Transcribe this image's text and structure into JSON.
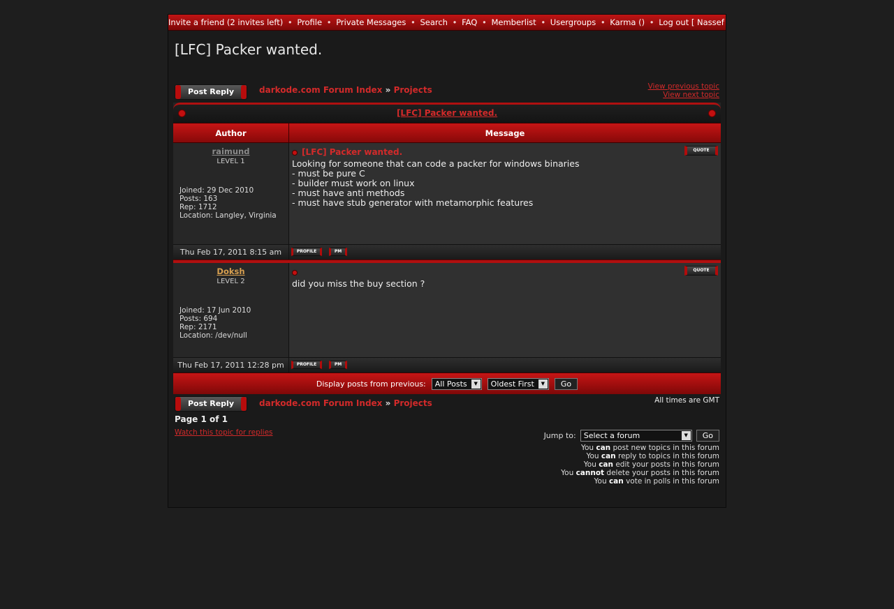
{
  "nav": {
    "items": [
      "Invite a friend (2 invites left)",
      "Profile",
      "Private Messages",
      "Search",
      "FAQ",
      "Memberlist",
      "Usergroups",
      "Karma ()",
      "Log out [ Nassef ]"
    ],
    "separator": "•"
  },
  "page_title": "[LFC] Packer wanted.",
  "post_reply_label": "Post Reply",
  "breadcrumb": {
    "index": "darkode.com Forum Index",
    "arrow": "»",
    "forum": "Projects"
  },
  "topic_links": {
    "previous": "View previous topic",
    "next": "View next topic"
  },
  "panel": {
    "title": "[LFC] Packer wanted.",
    "col_author": "Author",
    "col_message": "Message"
  },
  "posts": [
    {
      "author": "raimund",
      "level": "LEVEL 1",
      "joined": "Joined: 29 Dec 2010",
      "posts": "Posts: 163",
      "rep": "Rep: 1712",
      "location": "Location: Langley, Virginia",
      "subject": "[LFC] Packer wanted.",
      "body": [
        "Looking for someone that can code a packer for windows binaries",
        "- must be pure C",
        "- builder must work on linux",
        "- must have anti methods",
        "- must have stub generator with metamorphic features"
      ],
      "date": "Thu Feb 17, 2011 8:15 am"
    },
    {
      "author": "Doksh",
      "level": "LEVEL 2",
      "joined": "Joined: 17 Jun 2010",
      "posts": "Posts: 694",
      "rep": "Rep: 2171",
      "location": "Location: /dev/null",
      "subject": "",
      "body": [
        "did you miss the buy section ?"
      ],
      "date": "Thu Feb 17, 2011 12:28 pm"
    }
  ],
  "buttons": {
    "quote": "QUOTE",
    "profile": "PROFILE",
    "pm": "PM"
  },
  "sort": {
    "label": "Display posts from previous:",
    "period": "All Posts",
    "order": "Oldest First",
    "go": "Go"
  },
  "timezone": "All times are GMT",
  "pagination": "Page 1 of 1",
  "watch_link": "Watch this topic for replies",
  "jump": {
    "label": "Jump to:",
    "select": "Select a forum",
    "go": "Go"
  },
  "permissions": [
    {
      "pre": "You ",
      "mode": "can",
      "post": " post new topics in this forum"
    },
    {
      "pre": "You ",
      "mode": "can",
      "post": " reply to topics in this forum"
    },
    {
      "pre": "You ",
      "mode": "can",
      "post": " edit your posts in this forum"
    },
    {
      "pre": "You ",
      "mode": "cannot",
      "post": " delete your posts in this forum"
    },
    {
      "pre": "You ",
      "mode": "can",
      "post": " vote in polls in this forum"
    }
  ],
  "colors": {
    "accent": "#d22a2a",
    "bar": "#b01010",
    "bg": "#1e1e1e"
  }
}
